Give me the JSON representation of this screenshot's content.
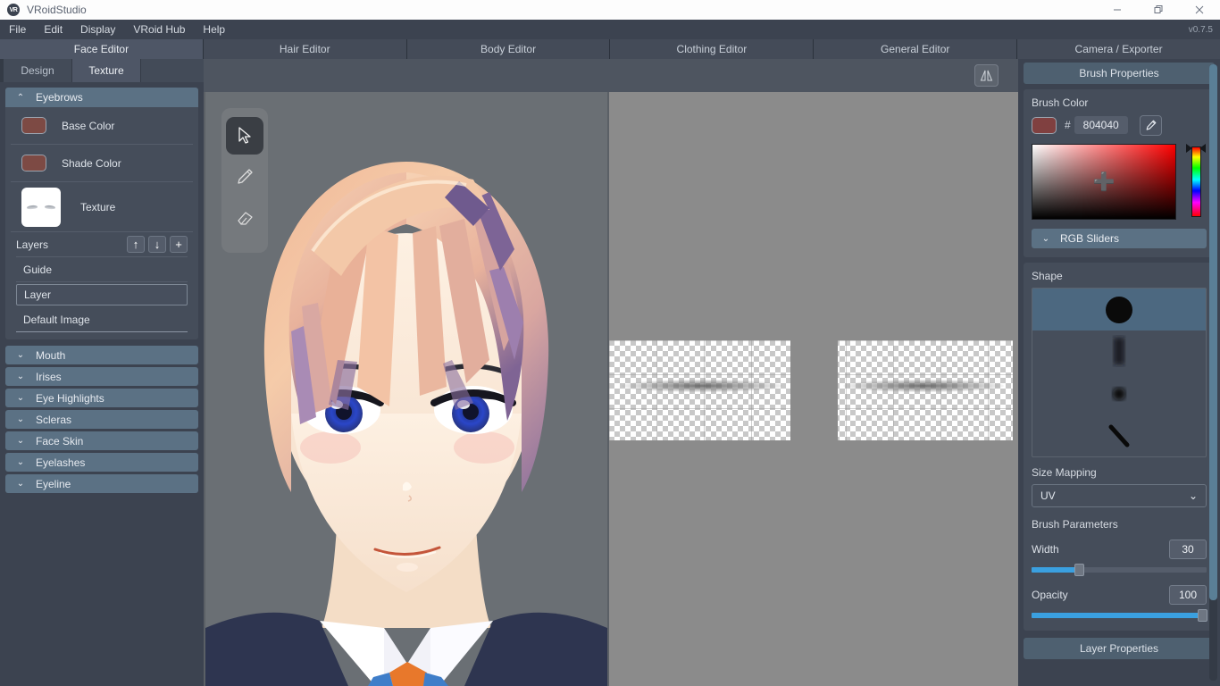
{
  "window": {
    "app_title": "VRoidStudio",
    "logo_text": "VR",
    "minimize_label": "minimize",
    "maximize_label": "restore",
    "close_label": "close"
  },
  "menu": {
    "items": [
      "File",
      "Edit",
      "Display",
      "VRoid Hub",
      "Help"
    ],
    "version": "v0.7.5"
  },
  "editor_tabs": [
    {
      "label": "Face Editor",
      "active": true
    },
    {
      "label": "Hair Editor",
      "active": false
    },
    {
      "label": "Body Editor",
      "active": false
    },
    {
      "label": "Clothing Editor",
      "active": false
    },
    {
      "label": "General Editor",
      "active": false
    },
    {
      "label": "Camera / Exporter",
      "active": false
    }
  ],
  "left_panel": {
    "tabs": [
      {
        "label": "Design",
        "active": false
      },
      {
        "label": "Texture",
        "active": true
      }
    ],
    "expanded_group": {
      "title": "Eyebrows",
      "chevron": "⌃",
      "base_color": {
        "label": "Base Color",
        "color": "#7d4a44"
      },
      "shade_color": {
        "label": "Shade Color",
        "color": "#7d4a44"
      },
      "texture": {
        "label": "Texture"
      },
      "layers": {
        "label": "Layers",
        "move_up": "↑",
        "move_down": "↓",
        "add": "+",
        "items": [
          {
            "name": "Guide",
            "selected": false
          },
          {
            "name": "Layer",
            "selected": true
          },
          {
            "name": "Default Image",
            "selected": false
          }
        ]
      }
    },
    "collapsed_groups": [
      {
        "label": "Mouth"
      },
      {
        "label": "Irises"
      },
      {
        "label": "Eye Highlights"
      },
      {
        "label": "Scleras"
      },
      {
        "label": "Face Skin"
      },
      {
        "label": "Eyelashes"
      },
      {
        "label": "Eyeline"
      }
    ],
    "collapsed_chevron": "⌄"
  },
  "viewport": {
    "mirror_tool_name": "symmetry-mirror",
    "tools": [
      {
        "name": "select-tool",
        "active": true
      },
      {
        "name": "pencil-tool",
        "active": false
      },
      {
        "name": "eraser-tool",
        "active": false
      }
    ]
  },
  "right_panel": {
    "header": "Brush Properties",
    "brush_color": {
      "label": "Brush Color",
      "hash": "#",
      "hex": "804040",
      "swatch": "#804040",
      "eyedropper_name": "eyedropper-tool"
    },
    "rgb_sliders": {
      "label": "RGB Sliders",
      "chevron": "⌄"
    },
    "shape": {
      "label": "Shape",
      "items": [
        {
          "name": "hard-round-brush",
          "selected": true
        },
        {
          "name": "soft-square-brush",
          "selected": false
        },
        {
          "name": "soft-round-brush",
          "selected": false
        },
        {
          "name": "angled-flat-brush",
          "selected": false
        }
      ]
    },
    "size_mapping": {
      "label": "Size Mapping",
      "value": "UV",
      "chevron": "⌄"
    },
    "brush_parameters": {
      "label": "Brush Parameters",
      "width": {
        "label": "Width",
        "value": "30",
        "percent": 27
      },
      "opacity": {
        "label": "Opacity",
        "value": "100",
        "percent": 100
      }
    },
    "layer_properties": "Layer Properties"
  }
}
